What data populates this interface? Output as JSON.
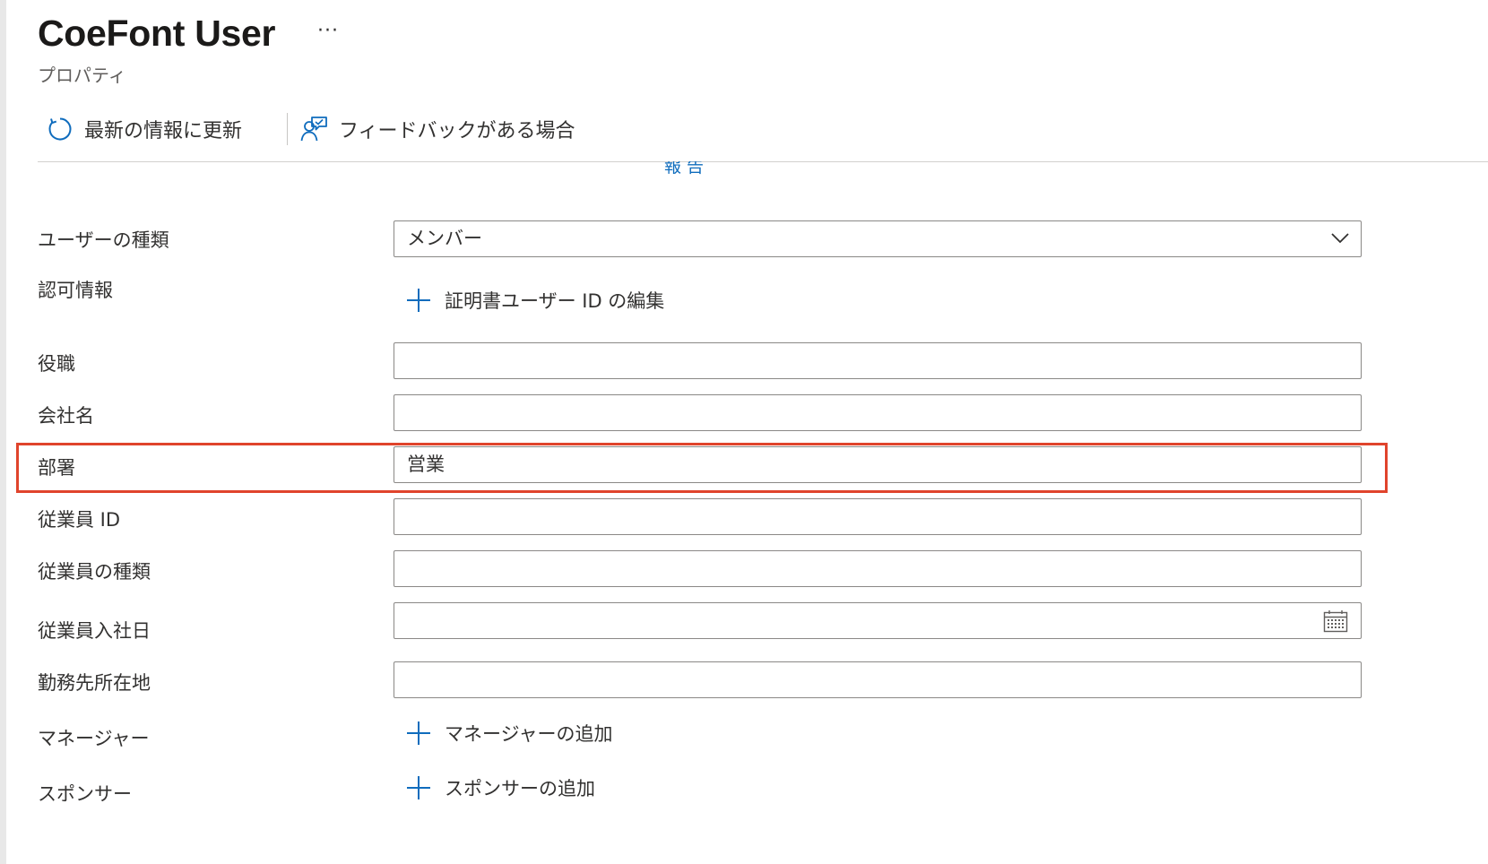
{
  "header": {
    "title": "CoeFont User",
    "more_label": "···",
    "subtitle": "プロパティ"
  },
  "toolbar": {
    "refresh_label": "最新の情報に更新",
    "feedback_label": "フィードバックがある場合"
  },
  "clipped_text": "報 告",
  "form": {
    "user_type": {
      "label": "ユーザーの種類",
      "value": "メンバー"
    },
    "authorization": {
      "label": "認可情報",
      "action": "証明書ユーザー ID の編集"
    },
    "job_title": {
      "label": "役職",
      "value": ""
    },
    "company_name": {
      "label": "会社名",
      "value": ""
    },
    "department": {
      "label": "部署",
      "value": "営業"
    },
    "employee_id": {
      "label": "従業員 ID",
      "value": ""
    },
    "employee_type": {
      "label": "従業員の種類",
      "value": ""
    },
    "hire_date": {
      "label": "従業員入社日",
      "value": ""
    },
    "office_location": {
      "label": "勤務先所在地",
      "value": ""
    },
    "manager": {
      "label": "マネージャー",
      "action": "マネージャーの追加"
    },
    "sponsor": {
      "label": "スポンサー",
      "action": "スポンサーの追加"
    }
  },
  "colors": {
    "accent": "#0f6cbd",
    "highlight": "#e0442c",
    "border": "#8a8886"
  },
  "icons": [
    "refresh-icon",
    "feedback-icon",
    "chevron-down-icon",
    "plus-icon",
    "calendar-icon"
  ]
}
